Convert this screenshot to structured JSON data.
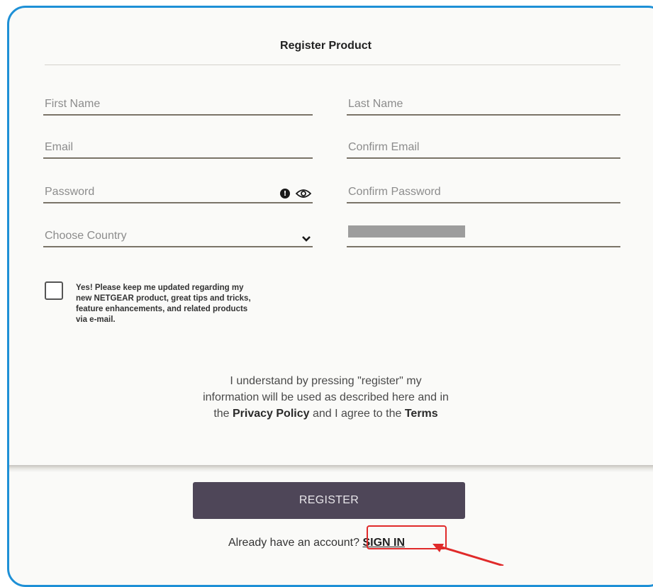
{
  "form": {
    "title": "Register Product",
    "fields": {
      "first_name": "First Name",
      "last_name": "Last Name",
      "email": "Email",
      "confirm_email": "Confirm Email",
      "password": "Password",
      "confirm_password": "Confirm Password",
      "country": "Choose Country"
    },
    "consent_text": "Yes! Please keep me updated regarding my\nnew NETGEAR product, great tips and tricks,\nfeature enhancements, and related products\nvia e-mail.",
    "legal": {
      "line1": "I understand by pressing \"register\" my",
      "line2": "information will be used as described here and in",
      "line3_prefix": "the ",
      "privacy_link": "Privacy Policy",
      "line3_mid": " and I agree to the ",
      "terms_link": "Terms"
    },
    "register_label": "REGISTER",
    "signin_prompt": "Already have an account? ",
    "signin_label": "SIGN IN"
  },
  "colors": {
    "frame_border": "#1e90d6",
    "button_bg": "#4e4658",
    "highlight": "#e02a2a"
  },
  "icons": [
    "info-icon",
    "eye-icon",
    "chevron-down-icon",
    "arrow-icon"
  ]
}
